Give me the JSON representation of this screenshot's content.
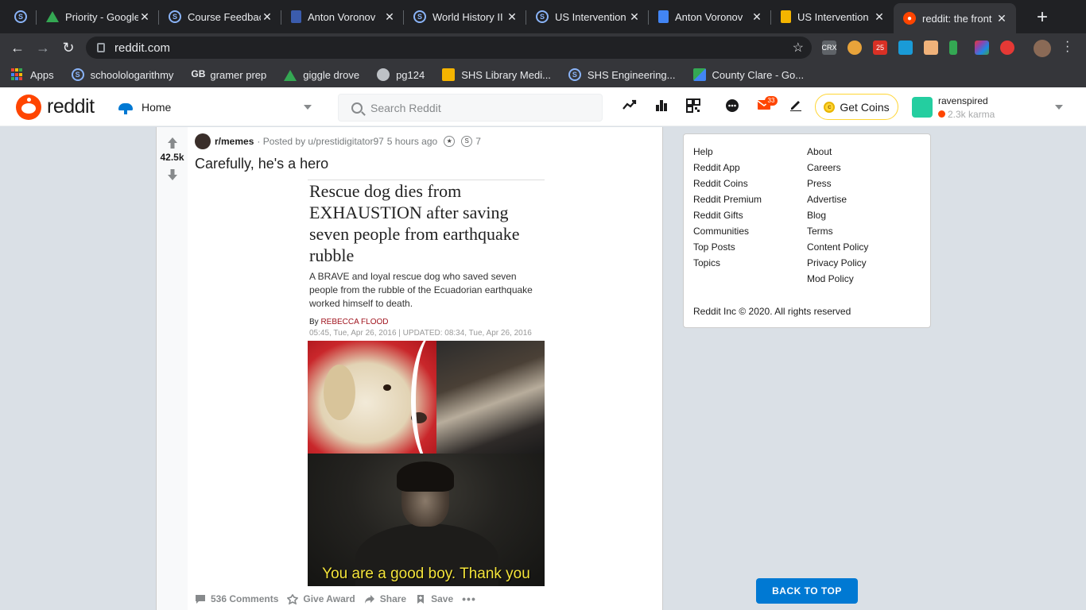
{
  "browser": {
    "tabs": [
      {
        "title": "",
        "favicon": "schoology-icon"
      },
      {
        "title": "Priority - Google",
        "favicon": "google-drive-icon"
      },
      {
        "title": "Course Feedback",
        "favicon": "schoology-icon"
      },
      {
        "title": "Anton Voronov",
        "favicon": "document-icon"
      },
      {
        "title": "World History II",
        "favicon": "schoology-icon"
      },
      {
        "title": "US Intervention",
        "favicon": "schoology-icon"
      },
      {
        "title": "Anton Voronov",
        "favicon": "google-docs-icon"
      },
      {
        "title": "US Intervention",
        "favicon": "google-slides-icon"
      },
      {
        "title": "reddit: the front",
        "favicon": "reddit-icon",
        "active": true
      }
    ],
    "new_tab": "+",
    "url": "reddit.com",
    "extensions": [
      {
        "label": "CRX",
        "color": "#5f6368"
      },
      {
        "label": "",
        "color": "#e8a33a"
      },
      {
        "label": "25",
        "color": "#d93025"
      },
      {
        "label": "",
        "color": "#1a9bd7"
      },
      {
        "label": "",
        "color": "#f0b27a"
      },
      {
        "label": "",
        "color": "#34a853"
      },
      {
        "label": "",
        "color": "#8e44ad"
      },
      {
        "label": "",
        "color": "#e53935"
      }
    ],
    "bookmarks": [
      {
        "label": "Apps",
        "icon": "apps-grid-icon"
      },
      {
        "label": "schoolologarithmy",
        "icon": "schoology-icon"
      },
      {
        "label": "gramer prep",
        "icon": "gb-icon"
      },
      {
        "label": "giggle drove",
        "icon": "google-drive-icon"
      },
      {
        "label": "pg124",
        "icon": "globe-icon"
      },
      {
        "label": "SHS Library Medi...",
        "icon": "library-icon"
      },
      {
        "label": "SHS Engineering...",
        "icon": "schoology-icon"
      },
      {
        "label": "County Clare - Go...",
        "icon": "google-maps-icon"
      }
    ]
  },
  "reddit": {
    "brand": "reddit",
    "home_label": "Home",
    "search_placeholder": "Search Reddit",
    "mail_count": "33",
    "get_coins": "Get Coins",
    "username": "ravenspired",
    "karma": "2.3k karma"
  },
  "post": {
    "score": "42.5k",
    "subreddit": "r/memes",
    "posted_by": "· Posted by u/prestidigitator97",
    "time": "5 hours ago",
    "award_count": "7",
    "title": "Carefully, he's a hero",
    "image": {
      "headline": "Rescue dog dies from EXHAUSTION after saving seven people from earthquake rubble",
      "lede": "A BRAVE and loyal rescue dog who saved seven people from the rubble of the Ecuadorian earthquake worked himself to death.",
      "by_prefix": "By ",
      "author": "REBECCA FLOOD",
      "date": "05:45, Tue, Apr 26, 2016 | UPDATED: 08:34, Tue, Apr 26, 2016",
      "caption": "You are a good boy. Thank you"
    },
    "actions": {
      "comments": "536 Comments",
      "give_award": "Give Award",
      "share": "Share",
      "save": "Save",
      "more": "•••"
    }
  },
  "sidebar": {
    "col_a": [
      "Help",
      "Reddit App",
      "Reddit Coins",
      "Reddit Premium",
      "Reddit Gifts",
      "Communities",
      "Top Posts",
      "Topics"
    ],
    "col_b": [
      "About",
      "Careers",
      "Press",
      "Advertise",
      "Blog",
      "Terms",
      "Content Policy",
      "Privacy Policy",
      "Mod Policy"
    ],
    "copyright": "Reddit Inc © 2020. All rights reserved"
  },
  "back_to_top": "BACK TO TOP"
}
